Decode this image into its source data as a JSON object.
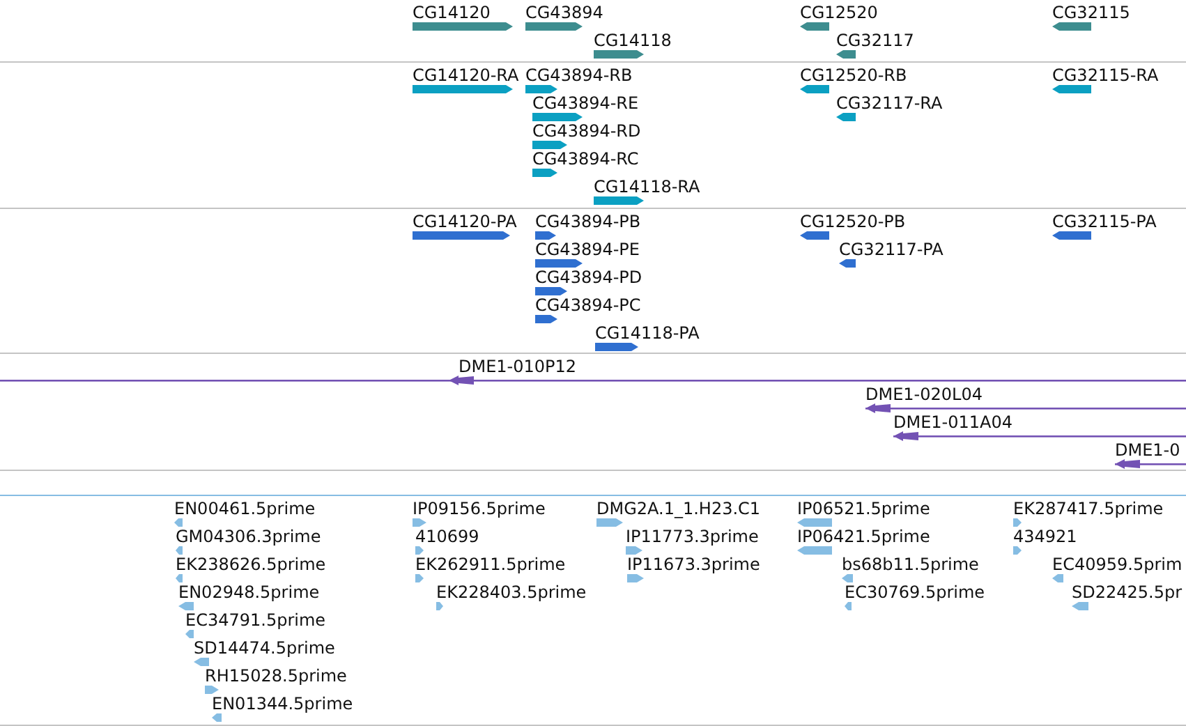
{
  "tracks": [
    {
      "kind": "gene",
      "features": [
        {
          "label": "CG14120",
          "reverse": false
        },
        {
          "label": "CG43894",
          "reverse": false
        },
        {
          "label": "CG14118",
          "reverse": false
        },
        {
          "label": "CG12520",
          "reverse": true
        },
        {
          "label": "CG32117",
          "reverse": true
        },
        {
          "label": "CG32115",
          "reverse": true
        }
      ]
    },
    {
      "kind": "transcript",
      "features": [
        {
          "label": "CG14120-RA",
          "reverse": false
        },
        {
          "label": "CG43894-RB",
          "reverse": false
        },
        {
          "label": "CG43894-RE",
          "reverse": false
        },
        {
          "label": "CG43894-RD",
          "reverse": false
        },
        {
          "label": "CG43894-RC",
          "reverse": false
        },
        {
          "label": "CG14118-RA",
          "reverse": false
        },
        {
          "label": "CG12520-RB",
          "reverse": true
        },
        {
          "label": "CG32117-RA",
          "reverse": true
        },
        {
          "label": "CG32115-RA",
          "reverse": true
        }
      ]
    },
    {
      "kind": "protein",
      "features": [
        {
          "label": "CG14120-PA",
          "reverse": false
        },
        {
          "label": "CG43894-PB",
          "reverse": false
        },
        {
          "label": "CG43894-PE",
          "reverse": false
        },
        {
          "label": "CG43894-PD",
          "reverse": false
        },
        {
          "label": "CG43894-PC",
          "reverse": false
        },
        {
          "label": "CG14118-PA",
          "reverse": false
        },
        {
          "label": "CG12520-PB",
          "reverse": true
        },
        {
          "label": "CG32117-PA",
          "reverse": true
        },
        {
          "label": "CG32115-PA",
          "reverse": true
        }
      ]
    },
    {
      "kind": "clone",
      "features": [
        {
          "label": "DME1-010P12",
          "reverse": true
        },
        {
          "label": "DME1-020L04",
          "reverse": true
        },
        {
          "label": "DME1-011A04",
          "reverse": true
        },
        {
          "label": "DME1-0",
          "reverse": true
        }
      ]
    },
    {
      "kind": "est",
      "features": [
        {
          "label": "EN00461.5prime",
          "reverse": true
        },
        {
          "label": "GM04306.3prime",
          "reverse": true
        },
        {
          "label": "EK238626.5prime",
          "reverse": true
        },
        {
          "label": "EN02948.5prime",
          "reverse": true
        },
        {
          "label": "EC34791.5prime",
          "reverse": true
        },
        {
          "label": "SD14474.5prime",
          "reverse": true
        },
        {
          "label": "RH15028.5prime",
          "reverse": false
        },
        {
          "label": "EN01344.5prime",
          "reverse": true
        },
        {
          "label": "IP09156.5prime",
          "reverse": false
        },
        {
          "label": "410699",
          "reverse": false
        },
        {
          "label": "EK262911.5prime",
          "reverse": false
        },
        {
          "label": "EK228403.5prime",
          "reverse": false
        },
        {
          "label": "DMG2A.1_1.H23.C1",
          "reverse": false
        },
        {
          "label": "IP11773.3prime",
          "reverse": false
        },
        {
          "label": "IP11673.3prime",
          "reverse": false
        },
        {
          "label": "IP06521.5prime",
          "reverse": true
        },
        {
          "label": "IP06421.5prime",
          "reverse": true
        },
        {
          "label": "bs68b11.5prime",
          "reverse": true
        },
        {
          "label": "EC30769.5prime",
          "reverse": true
        },
        {
          "label": "EK287417.5prime",
          "reverse": false
        },
        {
          "label": "434921",
          "reverse": false
        },
        {
          "label": "EC40959.5prim",
          "reverse": true
        },
        {
          "label": "SD22425.5pr",
          "reverse": true
        }
      ]
    }
  ]
}
